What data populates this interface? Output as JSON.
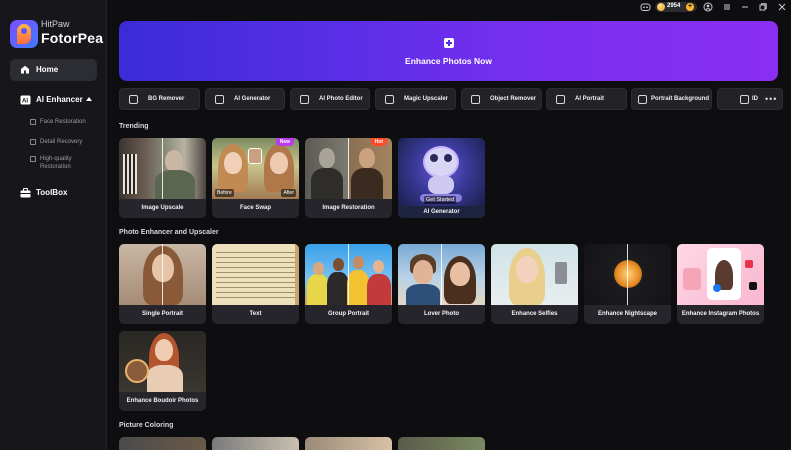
{
  "app": {
    "brand_small": "HitPaw",
    "brand_big": "FotorPea"
  },
  "titlebar": {
    "coins": "2954",
    "coin_plus": "+"
  },
  "sidebar": {
    "home": "Home",
    "ai_enhancer": "AI Enhancer",
    "sub_items": [
      "Face Restoration",
      "Detail Recovery",
      "High-quality Restoration"
    ],
    "toolbox": "ToolBox"
  },
  "hero": {
    "label": "Enhance Photos Now"
  },
  "tools": [
    {
      "label": "BG Remover",
      "icon": "bg-remover-icon"
    },
    {
      "label": "AI Generator",
      "icon": "ai-generator-icon"
    },
    {
      "label": "AI Photo Editor",
      "icon": "photo-editor-icon"
    },
    {
      "label": "Magic Upscaler",
      "icon": "upscaler-icon"
    },
    {
      "label": "Object Remover",
      "icon": "eraser-icon"
    },
    {
      "label": "AI Portrait",
      "icon": "portrait-icon"
    },
    {
      "label": "Portrait Background",
      "icon": "background-icon"
    },
    {
      "label": "ID",
      "icon": "id-icon"
    }
  ],
  "sections": {
    "trending": "Trending",
    "enhancer": "Photo Enhancer and Upscaler",
    "coloring": "Picture Coloring"
  },
  "trending": [
    {
      "label": "Image Upscale"
    },
    {
      "label": "Face Swap",
      "badge": "New",
      "before": "Before",
      "after": "After"
    },
    {
      "label": "Image Restoration",
      "badge": "Hot"
    },
    {
      "label": "AI Generator",
      "cta": "Get Started"
    }
  ],
  "enhancer": [
    {
      "label": "Single Portrait"
    },
    {
      "label": "Text"
    },
    {
      "label": "Group Portrait"
    },
    {
      "label": "Lover Photo"
    },
    {
      "label": "Enhance Selfies"
    },
    {
      "label": "Enhance Nightscape"
    },
    {
      "label": "Enhance Instagram Photos"
    },
    {
      "label": "Enhance Boudoir Photos"
    }
  ],
  "colors": {
    "accent": "#7a2ff0",
    "new_badge": "#b93cf0",
    "hot_badge": "#ff4a2a"
  }
}
